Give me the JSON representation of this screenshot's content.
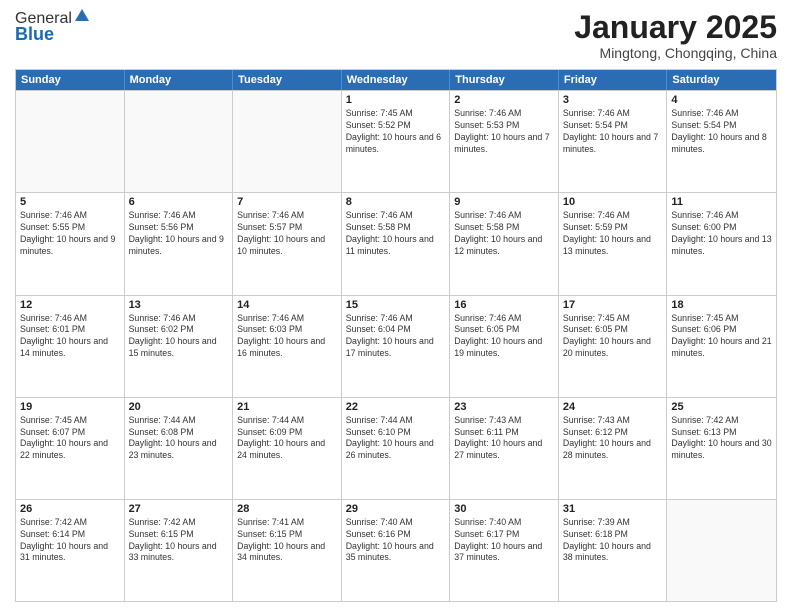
{
  "header": {
    "logo_general": "General",
    "logo_blue": "Blue",
    "title": "January 2025",
    "subtitle": "Mingtong, Chongqing, China"
  },
  "days_of_week": [
    "Sunday",
    "Monday",
    "Tuesday",
    "Wednesday",
    "Thursday",
    "Friday",
    "Saturday"
  ],
  "weeks": [
    [
      {
        "day": "",
        "info": ""
      },
      {
        "day": "",
        "info": ""
      },
      {
        "day": "",
        "info": ""
      },
      {
        "day": "1",
        "info": "Sunrise: 7:45 AM\nSunset: 5:52 PM\nDaylight: 10 hours and 6 minutes."
      },
      {
        "day": "2",
        "info": "Sunrise: 7:46 AM\nSunset: 5:53 PM\nDaylight: 10 hours and 7 minutes."
      },
      {
        "day": "3",
        "info": "Sunrise: 7:46 AM\nSunset: 5:54 PM\nDaylight: 10 hours and 7 minutes."
      },
      {
        "day": "4",
        "info": "Sunrise: 7:46 AM\nSunset: 5:54 PM\nDaylight: 10 hours and 8 minutes."
      }
    ],
    [
      {
        "day": "5",
        "info": "Sunrise: 7:46 AM\nSunset: 5:55 PM\nDaylight: 10 hours and 9 minutes."
      },
      {
        "day": "6",
        "info": "Sunrise: 7:46 AM\nSunset: 5:56 PM\nDaylight: 10 hours and 9 minutes."
      },
      {
        "day": "7",
        "info": "Sunrise: 7:46 AM\nSunset: 5:57 PM\nDaylight: 10 hours and 10 minutes."
      },
      {
        "day": "8",
        "info": "Sunrise: 7:46 AM\nSunset: 5:58 PM\nDaylight: 10 hours and 11 minutes."
      },
      {
        "day": "9",
        "info": "Sunrise: 7:46 AM\nSunset: 5:58 PM\nDaylight: 10 hours and 12 minutes."
      },
      {
        "day": "10",
        "info": "Sunrise: 7:46 AM\nSunset: 5:59 PM\nDaylight: 10 hours and 13 minutes."
      },
      {
        "day": "11",
        "info": "Sunrise: 7:46 AM\nSunset: 6:00 PM\nDaylight: 10 hours and 13 minutes."
      }
    ],
    [
      {
        "day": "12",
        "info": "Sunrise: 7:46 AM\nSunset: 6:01 PM\nDaylight: 10 hours and 14 minutes."
      },
      {
        "day": "13",
        "info": "Sunrise: 7:46 AM\nSunset: 6:02 PM\nDaylight: 10 hours and 15 minutes."
      },
      {
        "day": "14",
        "info": "Sunrise: 7:46 AM\nSunset: 6:03 PM\nDaylight: 10 hours and 16 minutes."
      },
      {
        "day": "15",
        "info": "Sunrise: 7:46 AM\nSunset: 6:04 PM\nDaylight: 10 hours and 17 minutes."
      },
      {
        "day": "16",
        "info": "Sunrise: 7:46 AM\nSunset: 6:05 PM\nDaylight: 10 hours and 19 minutes."
      },
      {
        "day": "17",
        "info": "Sunrise: 7:45 AM\nSunset: 6:05 PM\nDaylight: 10 hours and 20 minutes."
      },
      {
        "day": "18",
        "info": "Sunrise: 7:45 AM\nSunset: 6:06 PM\nDaylight: 10 hours and 21 minutes."
      }
    ],
    [
      {
        "day": "19",
        "info": "Sunrise: 7:45 AM\nSunset: 6:07 PM\nDaylight: 10 hours and 22 minutes."
      },
      {
        "day": "20",
        "info": "Sunrise: 7:44 AM\nSunset: 6:08 PM\nDaylight: 10 hours and 23 minutes."
      },
      {
        "day": "21",
        "info": "Sunrise: 7:44 AM\nSunset: 6:09 PM\nDaylight: 10 hours and 24 minutes."
      },
      {
        "day": "22",
        "info": "Sunrise: 7:44 AM\nSunset: 6:10 PM\nDaylight: 10 hours and 26 minutes."
      },
      {
        "day": "23",
        "info": "Sunrise: 7:43 AM\nSunset: 6:11 PM\nDaylight: 10 hours and 27 minutes."
      },
      {
        "day": "24",
        "info": "Sunrise: 7:43 AM\nSunset: 6:12 PM\nDaylight: 10 hours and 28 minutes."
      },
      {
        "day": "25",
        "info": "Sunrise: 7:42 AM\nSunset: 6:13 PM\nDaylight: 10 hours and 30 minutes."
      }
    ],
    [
      {
        "day": "26",
        "info": "Sunrise: 7:42 AM\nSunset: 6:14 PM\nDaylight: 10 hours and 31 minutes."
      },
      {
        "day": "27",
        "info": "Sunrise: 7:42 AM\nSunset: 6:15 PM\nDaylight: 10 hours and 33 minutes."
      },
      {
        "day": "28",
        "info": "Sunrise: 7:41 AM\nSunset: 6:15 PM\nDaylight: 10 hours and 34 minutes."
      },
      {
        "day": "29",
        "info": "Sunrise: 7:40 AM\nSunset: 6:16 PM\nDaylight: 10 hours and 35 minutes."
      },
      {
        "day": "30",
        "info": "Sunrise: 7:40 AM\nSunset: 6:17 PM\nDaylight: 10 hours and 37 minutes."
      },
      {
        "day": "31",
        "info": "Sunrise: 7:39 AM\nSunset: 6:18 PM\nDaylight: 10 hours and 38 minutes."
      },
      {
        "day": "",
        "info": ""
      }
    ]
  ]
}
